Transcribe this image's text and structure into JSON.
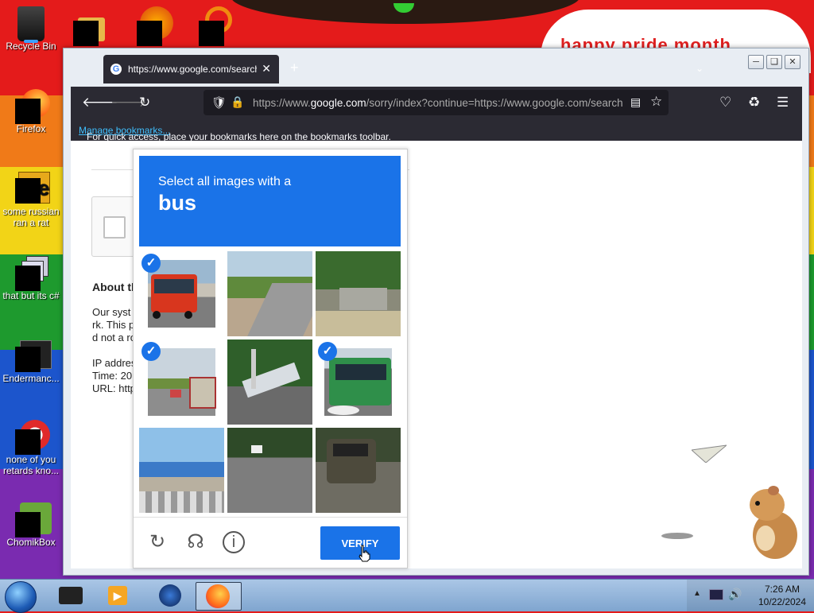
{
  "desktop": {
    "banner_text": "happy pride month",
    "icons": [
      {
        "label": "Recycle Bin"
      },
      {
        "label": "Firefox"
      },
      {
        "label": "some russian ran a rat"
      },
      {
        "label": "that but its c#"
      },
      {
        "label": "Endermanc..."
      },
      {
        "label": "none of you retards kno..."
      },
      {
        "label": "ChomikBox"
      }
    ]
  },
  "browser": {
    "tab_title": "https://www.google.com/search",
    "tab_close": "✕",
    "new_tab": "+",
    "url_prefix": "https://www.",
    "url_domain": "google.com",
    "url_rest": "/sorry/index?continue=https://www.google.com/search",
    "bookmarks_text": "For quick access, place your bookmarks here on the bookmarks toolbar.",
    "bookmarks_link": "Manage bookmarks...",
    "window_controls": [
      "minimize",
      "restore",
      "close"
    ]
  },
  "page": {
    "about_heading": "About th",
    "para_line1": "Our syst",
    "para_line2": "rk. This p",
    "para_line3": "d not a ro",
    "ip_line": "IP addres",
    "time_line": "Time: 20",
    "url_line": "URL: http"
  },
  "captcha": {
    "instruction": "Select all images with a",
    "target": "bus",
    "verify_label": "VERIFY",
    "accent_color": "#1a73e8",
    "tiles": [
      {
        "selected": true,
        "scene": "red bus"
      },
      {
        "selected": false,
        "scene": "road construction"
      },
      {
        "selected": false,
        "scene": "park wall"
      },
      {
        "selected": true,
        "scene": "road with bus"
      },
      {
        "selected": false,
        "scene": "overpass"
      },
      {
        "selected": true,
        "scene": "green bus"
      },
      {
        "selected": false,
        "scene": "street"
      },
      {
        "selected": false,
        "scene": "road"
      },
      {
        "selected": false,
        "scene": "old bus"
      }
    ]
  },
  "taskbar": {
    "time": "7:26 AM",
    "date": "10/22/2024"
  }
}
